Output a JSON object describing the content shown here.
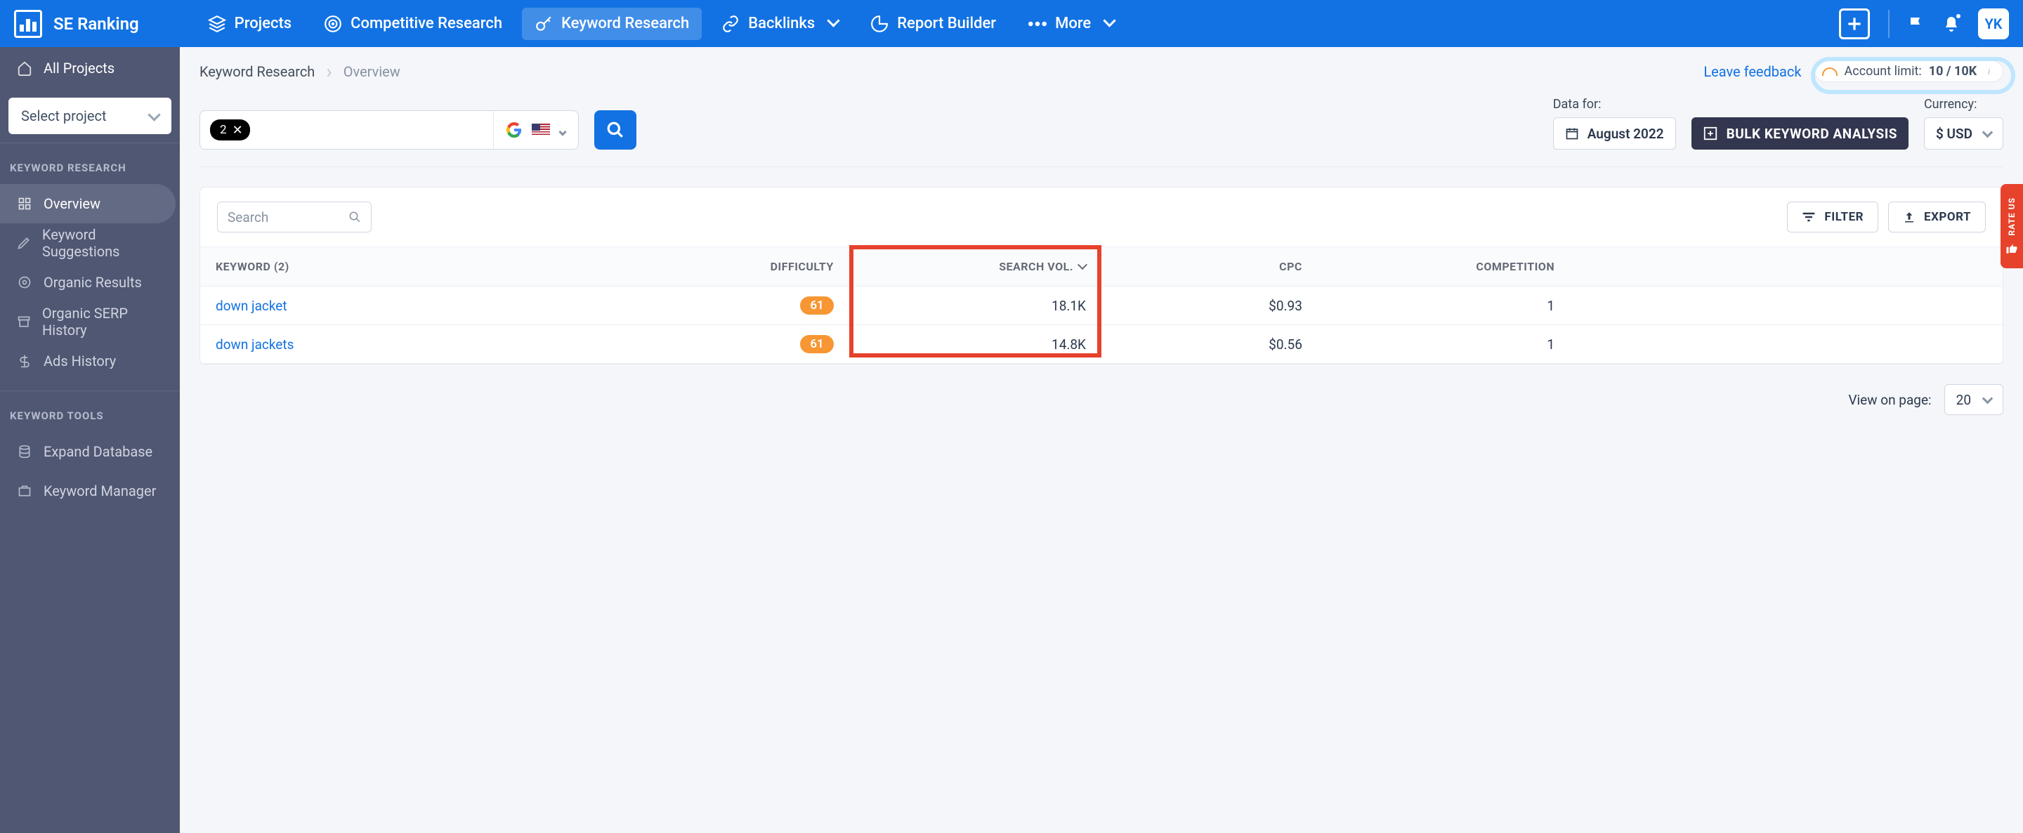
{
  "brand": "SE Ranking",
  "nav": {
    "projects": "Projects",
    "competitive": "Competitive Research",
    "keyword": "Keyword Research",
    "backlinks": "Backlinks",
    "report": "Report Builder",
    "more": "More"
  },
  "avatar_initials": "YK",
  "sidebar": {
    "all_projects": "All Projects",
    "select_project_placeholder": "Select project",
    "section_research": "KEYWORD RESEARCH",
    "items": {
      "overview": "Overview",
      "suggestions": "Keyword Suggestions",
      "organic": "Organic Results",
      "serp": "Organic SERP History",
      "ads": "Ads History"
    },
    "section_tools": "KEYWORD TOOLS",
    "tools": {
      "expand": "Expand Database",
      "manager": "Keyword Manager"
    }
  },
  "breadcrumb": {
    "root": "Keyword Research",
    "leaf": "Overview"
  },
  "feedback": "Leave feedback",
  "limit": {
    "label": "Account limit:",
    "value": "10 / 10K"
  },
  "search_chip": "2",
  "data_for": {
    "label": "Data for:",
    "value": "August 2022"
  },
  "bulk_btn": "BULK KEYWORD ANALYSIS",
  "currency": {
    "label": "Currency:",
    "value": "$ USD"
  },
  "panel": {
    "search_placeholder": "Search",
    "filter": "FILTER",
    "export": "EXPORT"
  },
  "table": {
    "headers": {
      "keyword": "KEYWORD  (2)",
      "difficulty": "DIFFICULTY",
      "volume": "SEARCH VOL.",
      "cpc": "CPC",
      "competition": "COMPETITION"
    },
    "rows": [
      {
        "keyword": "down jacket",
        "difficulty": "61",
        "volume": "18.1K",
        "cpc": "$0.93",
        "competition": "1"
      },
      {
        "keyword": "down jackets",
        "difficulty": "61",
        "volume": "14.8K",
        "cpc": "$0.56",
        "competition": "1"
      }
    ]
  },
  "pager": {
    "label": "View on page:",
    "value": "20"
  },
  "rate_us": "RATE US"
}
